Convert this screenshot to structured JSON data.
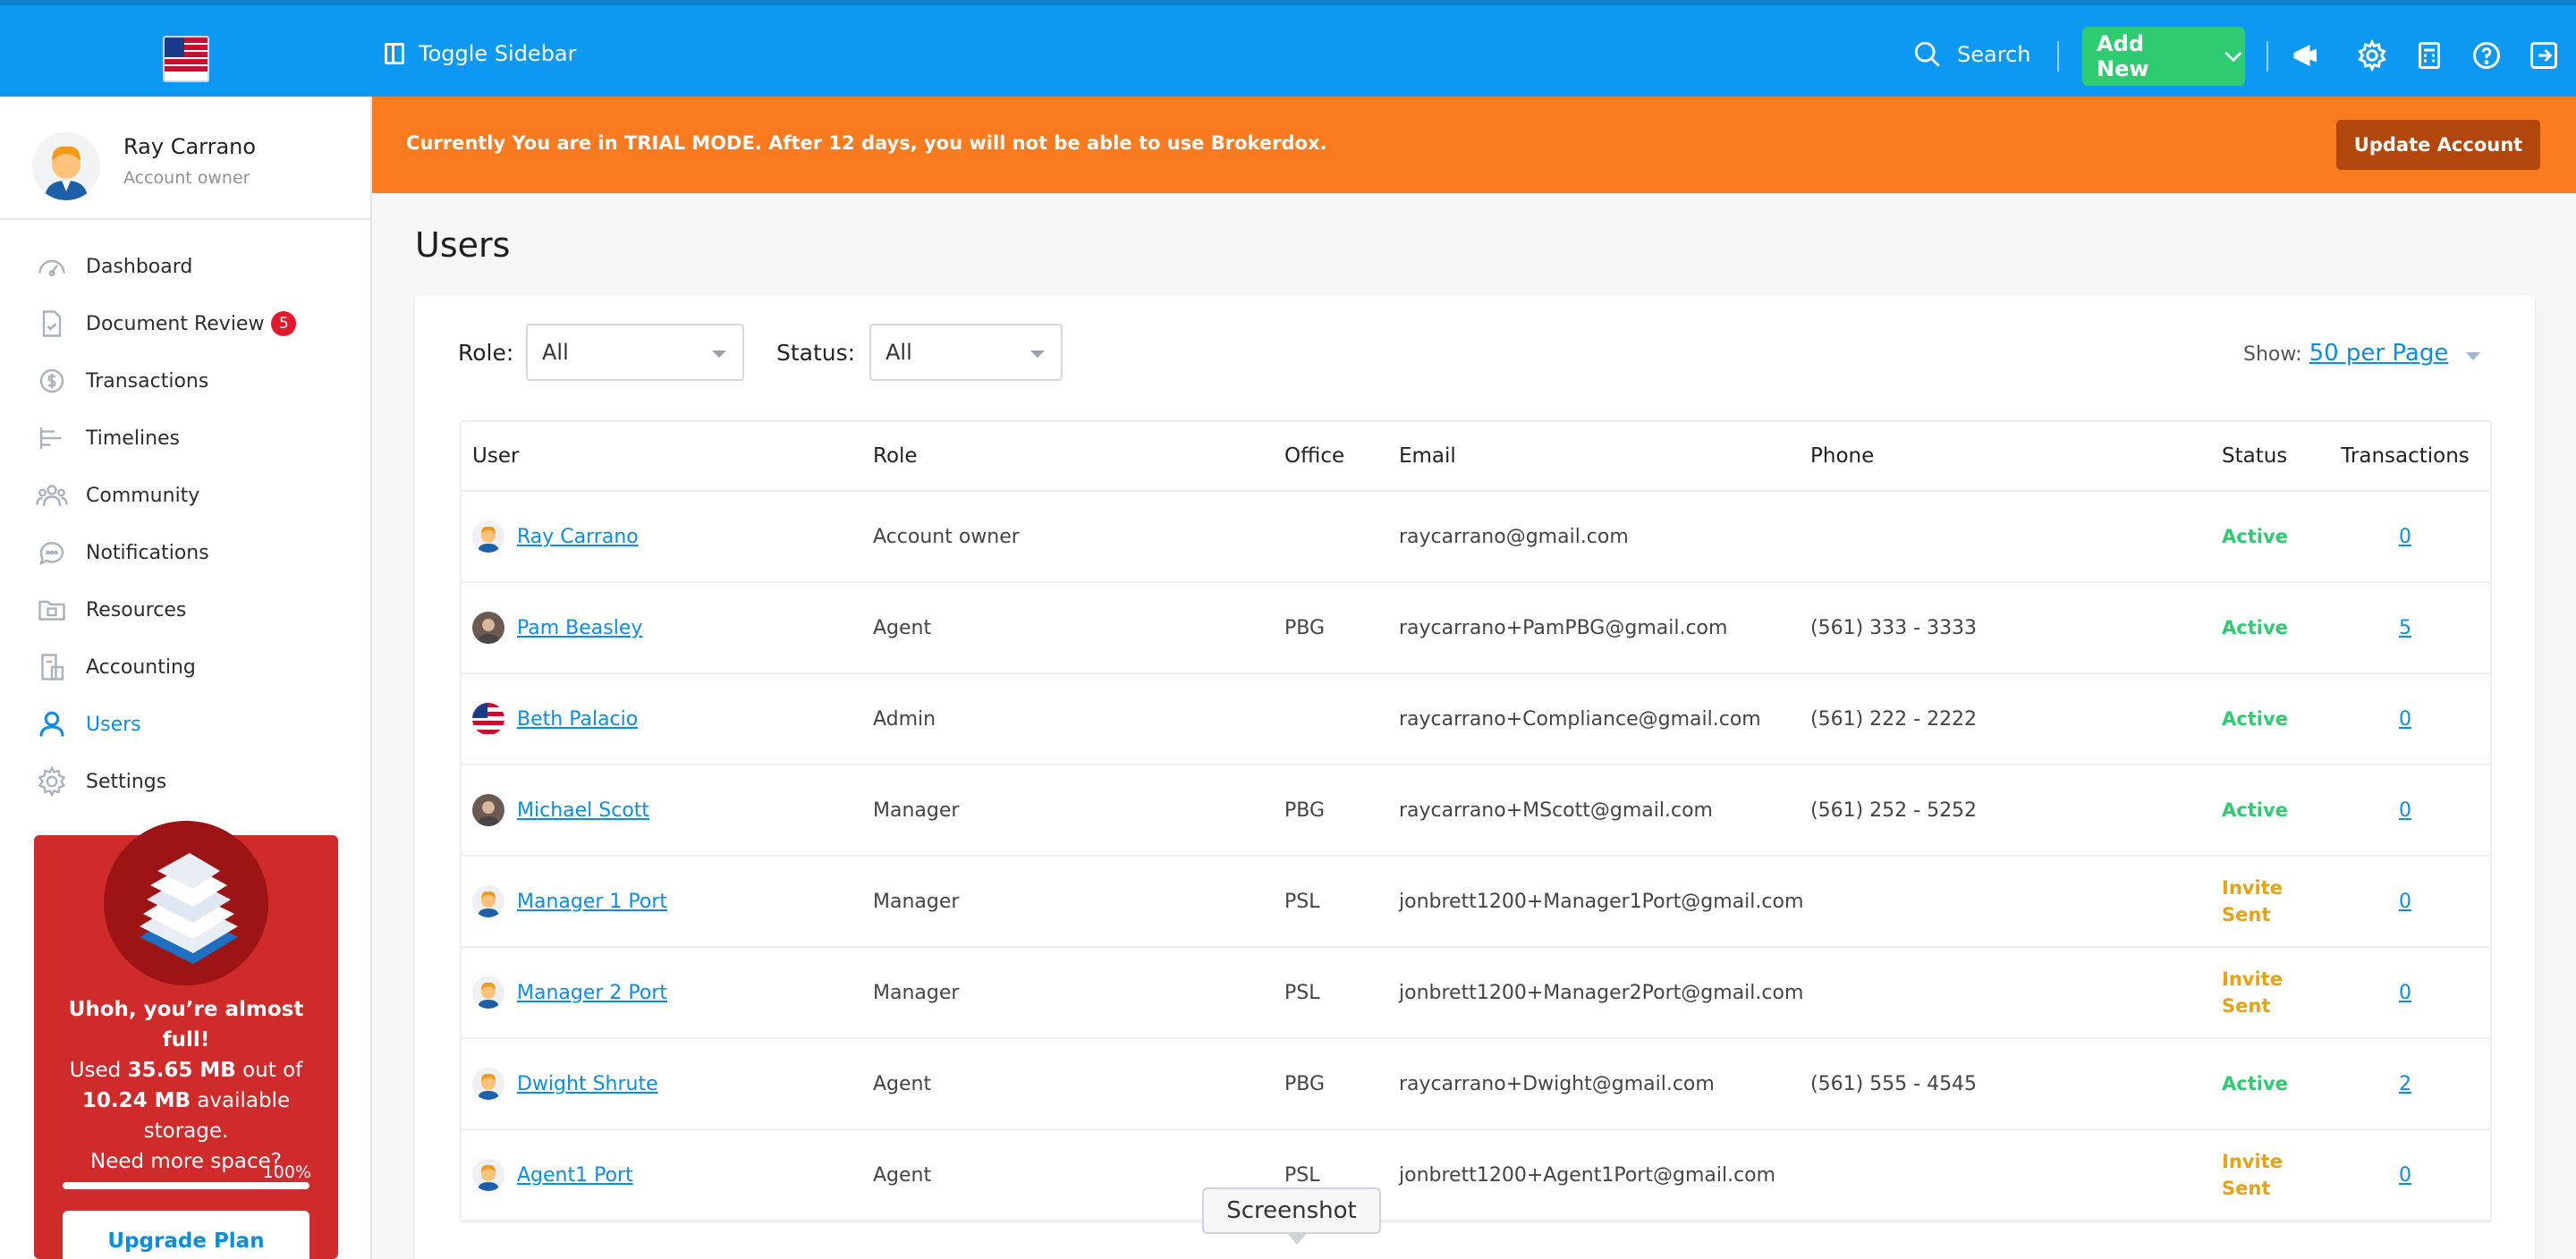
{
  "header": {
    "toggle_label": "Toggle Sidebar",
    "search_label": "Search",
    "add_new_label": "Add New",
    "brand_color": "#0d99f2"
  },
  "profile": {
    "name": "Ray Carrano",
    "role": "Account owner"
  },
  "sidebar": {
    "items": [
      {
        "label": "Dashboard",
        "icon": "dashboard-icon"
      },
      {
        "label": "Document Review",
        "icon": "document-review-icon",
        "badge": "5"
      },
      {
        "label": "Transactions",
        "icon": "transactions-icon"
      },
      {
        "label": "Timelines",
        "icon": "timelines-icon"
      },
      {
        "label": "Community",
        "icon": "community-icon"
      },
      {
        "label": "Notifications",
        "icon": "notifications-icon"
      },
      {
        "label": "Resources",
        "icon": "resources-icon"
      },
      {
        "label": "Accounting",
        "icon": "accounting-icon"
      },
      {
        "label": "Users",
        "icon": "users-icon",
        "active": true
      },
      {
        "label": "Settings",
        "icon": "settings-icon"
      }
    ]
  },
  "storage": {
    "headline": "Uhoh, you’re almost full!",
    "used_prefix": "Used",
    "used": "35.65 MB",
    "out_of": "out of",
    "available": "10.24 MB",
    "available_suffix": "available storage.",
    "need_more": "Need more space?",
    "percent_label": "100%",
    "percent": 100,
    "upgrade_label": "Upgrade Plan"
  },
  "trial": {
    "message": "Currently You are in TRIAL MODE. After 12 days, you will not be able to use Brokerdox.",
    "button_label": "Update Account"
  },
  "page": {
    "title": "Users"
  },
  "filters": {
    "role_label": "Role:",
    "role_value": "All",
    "status_label": "Status:",
    "status_value": "All",
    "show_label": "Show:",
    "show_value": "50 per Page"
  },
  "table": {
    "headers": [
      "User",
      "Role",
      "Office",
      "Email",
      "Phone",
      "Status",
      "Transactions"
    ],
    "rows": [
      {
        "user": "Ray Carrano",
        "role": "Account owner",
        "office": "",
        "email": "raycarrano@gmail.com",
        "phone": "",
        "status": "Active",
        "transactions": "0",
        "avatar": "cartoon"
      },
      {
        "user": "Pam Beasley",
        "role": "Agent",
        "office": "PBG",
        "email": "raycarrano+PamPBG@gmail.com",
        "phone": "(561) 333 - 3333",
        "status": "Active",
        "transactions": "5",
        "avatar": "photo"
      },
      {
        "user": "Beth Palacio",
        "role": "Admin",
        "office": "",
        "email": "raycarrano+Compliance@gmail.com",
        "phone": "(561) 222 - 2222",
        "status": "Active",
        "transactions": "0",
        "avatar": "flag"
      },
      {
        "user": "Michael Scott",
        "role": "Manager",
        "office": "PBG",
        "email": "raycarrano+MScott@gmail.com",
        "phone": "(561) 252 - 5252",
        "status": "Active",
        "transactions": "0",
        "avatar": "photo"
      },
      {
        "user": "Manager 1 Port",
        "role": "Manager",
        "office": "PSL",
        "email": "jonbrett1200+Manager1Port@gmail.com",
        "phone": "",
        "status": "Invite Sent",
        "transactions": "0",
        "avatar": "cartoon"
      },
      {
        "user": "Manager 2 Port",
        "role": "Manager",
        "office": "PSL",
        "email": "jonbrett1200+Manager2Port@gmail.com",
        "phone": "",
        "status": "Invite Sent",
        "transactions": "0",
        "avatar": "cartoon"
      },
      {
        "user": "Dwight Shrute",
        "role": "Agent",
        "office": "PBG",
        "email": "raycarrano+Dwight@gmail.com",
        "phone": "(561) 555 - 4545",
        "status": "Active",
        "transactions": "2",
        "avatar": "cartoon"
      },
      {
        "user": "Agent1 Port",
        "role": "Agent",
        "office": "PSL",
        "email": "jonbrett1200+Agent1Port@gmail.com",
        "phone": "",
        "status": "Invite Sent",
        "transactions": "0",
        "avatar": "cartoon"
      }
    ]
  },
  "tooltip": {
    "label": "Screenshot"
  }
}
